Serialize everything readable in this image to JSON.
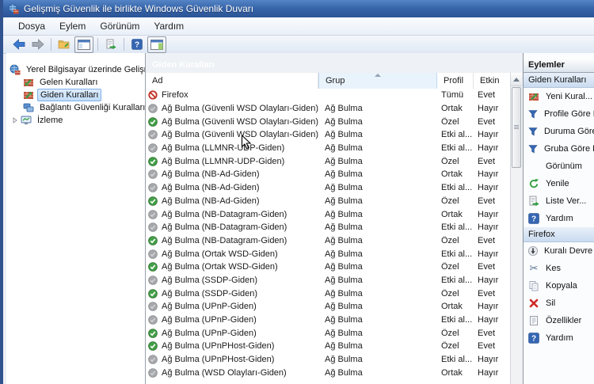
{
  "window": {
    "title": "Gelişmiş Güvenlik ile birlikte Windows Güvenlik Duvarı"
  },
  "menu": {
    "items": [
      "Dosya",
      "Eylem",
      "Görünüm",
      "Yardım"
    ]
  },
  "toolbar": {
    "icons": [
      "back",
      "forward",
      "show-hide-console-tree",
      "console-window",
      "export-list",
      "help",
      "show-hide-action-pane"
    ]
  },
  "tree": {
    "root": "Yerel Bilgisayar üzerinde Gelişm",
    "items": [
      {
        "label": "Gelen Kuralları",
        "icon": "inbound-rules",
        "selected": false
      },
      {
        "label": "Giden Kuralları",
        "icon": "outbound-rules",
        "selected": true
      },
      {
        "label": "Bağlantı Güvenliği Kuralları",
        "icon": "connection-security",
        "selected": false
      },
      {
        "label": "İzleme",
        "icon": "monitoring",
        "selected": false,
        "expandable": true
      }
    ]
  },
  "main": {
    "header": "Giden Kuralları",
    "columns": [
      "Ad",
      "Grup",
      "Profil",
      "Etkin"
    ],
    "sort": {
      "column": "Grup",
      "direction": "asc"
    },
    "rows": [
      {
        "name": "Firefox",
        "group": "",
        "profile": "Tümü",
        "enabled": "Evet",
        "state": "blocked"
      },
      {
        "name": "Ağ Bulma (Güvenli WSD Olayları-Giden)",
        "group": "Ağ Bulma",
        "profile": "Ortak",
        "enabled": "Hayır",
        "state": "disabled"
      },
      {
        "name": "Ağ Bulma (Güvenli WSD Olayları-Giden)",
        "group": "Ağ Bulma",
        "profile": "Özel",
        "enabled": "Evet",
        "state": "enabled"
      },
      {
        "name": "Ağ Bulma (Güvenli WSD Olayları-Giden)",
        "group": "Ağ Bulma",
        "profile": "Etki al...",
        "enabled": "Hayır",
        "state": "disabled"
      },
      {
        "name": "Ağ Bulma (LLMNR-UDP-Giden)",
        "group": "Ağ Bulma",
        "profile": "Etki al...",
        "enabled": "Hayır",
        "state": "disabled"
      },
      {
        "name": "Ağ Bulma (LLMNR-UDP-Giden)",
        "group": "Ağ Bulma",
        "profile": "Özel",
        "enabled": "Evet",
        "state": "enabled"
      },
      {
        "name": "Ağ Bulma (NB-Ad-Giden)",
        "group": "Ağ Bulma",
        "profile": "Ortak",
        "enabled": "Hayır",
        "state": "disabled"
      },
      {
        "name": "Ağ Bulma (NB-Ad-Giden)",
        "group": "Ağ Bulma",
        "profile": "Etki al...",
        "enabled": "Hayır",
        "state": "disabled"
      },
      {
        "name": "Ağ Bulma (NB-Ad-Giden)",
        "group": "Ağ Bulma",
        "profile": "Özel",
        "enabled": "Evet",
        "state": "enabled"
      },
      {
        "name": "Ağ Bulma (NB-Datagram-Giden)",
        "group": "Ağ Bulma",
        "profile": "Ortak",
        "enabled": "Hayır",
        "state": "disabled"
      },
      {
        "name": "Ağ Bulma (NB-Datagram-Giden)",
        "group": "Ağ Bulma",
        "profile": "Etki al...",
        "enabled": "Hayır",
        "state": "disabled"
      },
      {
        "name": "Ağ Bulma (NB-Datagram-Giden)",
        "group": "Ağ Bulma",
        "profile": "Özel",
        "enabled": "Evet",
        "state": "enabled"
      },
      {
        "name": "Ağ Bulma (Ortak WSD-Giden)",
        "group": "Ağ Bulma",
        "profile": "Etki al...",
        "enabled": "Hayır",
        "state": "disabled"
      },
      {
        "name": "Ağ Bulma (Ortak WSD-Giden)",
        "group": "Ağ Bulma",
        "profile": "Özel",
        "enabled": "Evet",
        "state": "enabled"
      },
      {
        "name": "Ağ Bulma (SSDP-Giden)",
        "group": "Ağ Bulma",
        "profile": "Etki al...",
        "enabled": "Hayır",
        "state": "disabled"
      },
      {
        "name": "Ağ Bulma (SSDP-Giden)",
        "group": "Ağ Bulma",
        "profile": "Özel",
        "enabled": "Evet",
        "state": "enabled"
      },
      {
        "name": "Ağ Bulma (UPnP-Giden)",
        "group": "Ağ Bulma",
        "profile": "Ortak",
        "enabled": "Hayır",
        "state": "disabled"
      },
      {
        "name": "Ağ Bulma (UPnP-Giden)",
        "group": "Ağ Bulma",
        "profile": "Etki al...",
        "enabled": "Hayır",
        "state": "disabled"
      },
      {
        "name": "Ağ Bulma (UPnP-Giden)",
        "group": "Ağ Bulma",
        "profile": "Özel",
        "enabled": "Evet",
        "state": "enabled"
      },
      {
        "name": "Ağ Bulma (UPnPHost-Giden)",
        "group": "Ağ Bulma",
        "profile": "Özel",
        "enabled": "Evet",
        "state": "enabled"
      },
      {
        "name": "Ağ Bulma (UPnPHost-Giden)",
        "group": "Ağ Bulma",
        "profile": "Etki al...",
        "enabled": "Hayır",
        "state": "disabled"
      },
      {
        "name": "Ağ Bulma (WSD Olayları-Giden)",
        "group": "Ağ Bulma",
        "profile": "Ortak",
        "enabled": "Hayır",
        "state": "disabled"
      }
    ]
  },
  "actions": {
    "title": "Eylemler",
    "sections": [
      {
        "title": "Giden Kuralları",
        "items": [
          {
            "label": "Yeni Kural...",
            "icon": "new-rule"
          },
          {
            "label": "Profile Göre Fil",
            "icon": "filter"
          },
          {
            "label": "Duruma Göre F",
            "icon": "filter"
          },
          {
            "label": "Gruba Göre Fil",
            "icon": "filter"
          },
          {
            "label": "Görünüm",
            "icon": ""
          },
          {
            "label": "Yenile",
            "icon": "refresh"
          },
          {
            "label": "Liste Ver...",
            "icon": "export-list"
          },
          {
            "label": "Yardım",
            "icon": "help"
          }
        ]
      },
      {
        "title": "Firefox",
        "items": [
          {
            "label": "Kuralı Devre Dı",
            "icon": "disable-rule"
          },
          {
            "label": "Kes",
            "icon": "cut"
          },
          {
            "label": "Kopyala",
            "icon": "copy"
          },
          {
            "label": "Sil",
            "icon": "delete"
          },
          {
            "label": "Özellikler",
            "icon": "properties"
          },
          {
            "label": "Yardım",
            "icon": "help"
          }
        ]
      }
    ]
  },
  "colors": {
    "titlebar_blue": "#2b5496",
    "panel_header_gray": "#595e64",
    "selection_blue": "#c2ddf8",
    "enabled_green": "#43a047",
    "disabled_gray": "#a6a8ab",
    "blocked_red": "#c0392b",
    "sorted_column_bg": "#e9f3fc"
  }
}
